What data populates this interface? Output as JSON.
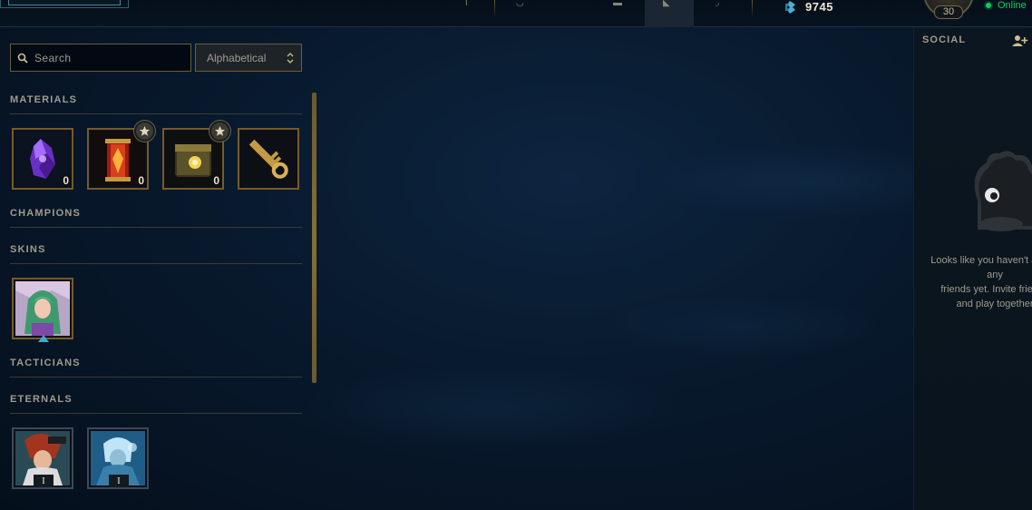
{
  "topbar": {
    "rp_value": "9745",
    "level": "30",
    "status": "Online"
  },
  "toolbar": {
    "search_placeholder": "Search",
    "sort_value": "Alphabetical"
  },
  "sections": {
    "materials": "MATERIALS",
    "champions": "CHAMPIONS",
    "skins": "SKINS",
    "tacticians": "TACTICIANS",
    "eternals": "ETERNALS"
  },
  "materials": [
    {
      "name": "orange-essence-crystal",
      "count": "0"
    },
    {
      "name": "masterwork-chest",
      "count": "0"
    },
    {
      "name": "hextech-chest",
      "count": "0"
    },
    {
      "name": "hextech-key",
      "count": ""
    }
  ],
  "eternals": [
    {
      "count": "I"
    },
    {
      "count": "I"
    }
  ],
  "social": {
    "title": "SOCIAL",
    "empty_message": "Looks like you haven't added any\nfriends yet. Invite friends\nand play together"
  },
  "colors": {
    "gold_border": "#785a28",
    "text_muted": "#a09b8c",
    "online_green": "#0acb6a"
  }
}
